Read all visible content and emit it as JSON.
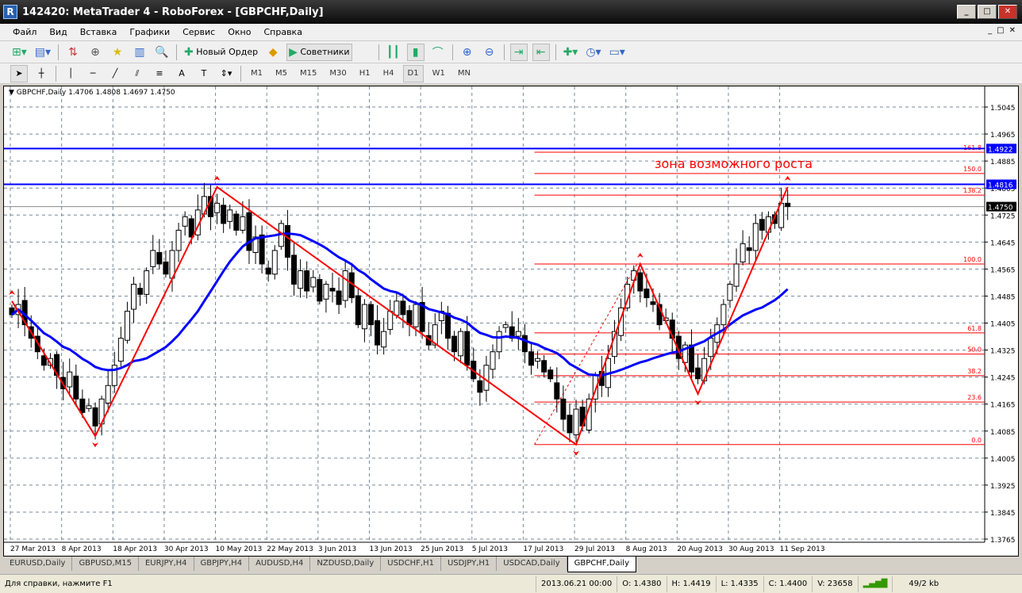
{
  "window": {
    "title": "142420: MetaTrader 4 - RoboForex - [GBPCHF,Daily]"
  },
  "menu": [
    "Файл",
    "Вид",
    "Вставка",
    "Графики",
    "Сервис",
    "Окно",
    "Справка"
  ],
  "toolbar": {
    "new_order": "Новый Ордер",
    "experts": "Советники"
  },
  "timeframes": [
    "M1",
    "M5",
    "M15",
    "M30",
    "H1",
    "H4",
    "D1",
    "W1",
    "MN"
  ],
  "active_timeframe": "D1",
  "chart_header": "GBPCHF,Daily  1.4706 1.4808 1.4697 1.4750",
  "annotation": "зона возможного роста",
  "colors": {
    "bull": "#ffffff",
    "bear": "#000000",
    "ma": "#0000ff",
    "zigzag": "#ff0000",
    "fib": "#ff0000",
    "hline": "#0000ff"
  },
  "chart_data": {
    "type": "candlestick",
    "symbol": "GBPCHF",
    "period": "Daily",
    "ylim": [
      1.3765,
      1.5045
    ],
    "price_ticks": [
      "1.5045",
      "1.4965",
      "1.4885",
      "1.4805",
      "1.4725",
      "1.4645",
      "1.4565",
      "1.4485",
      "1.4405",
      "1.4325",
      "1.4245",
      "1.4165",
      "1.4085",
      "1.4005",
      "1.3925",
      "1.3845",
      "1.3765"
    ],
    "date_ticks": [
      {
        "bar": 0,
        "label": "27 Mar 2013"
      },
      {
        "bar": 8,
        "label": "8 Apr 2013"
      },
      {
        "bar": 16,
        "label": "18 Apr 2013"
      },
      {
        "bar": 24,
        "label": "30 Apr 2013"
      },
      {
        "bar": 32,
        "label": "10 May 2013"
      },
      {
        "bar": 40,
        "label": "22 May 2013"
      },
      {
        "bar": 48,
        "label": "3 Jun 2013"
      },
      {
        "bar": 56,
        "label": "13 Jun 2013"
      },
      {
        "bar": 64,
        "label": "25 Jun 2013"
      },
      {
        "bar": 72,
        "label": "5 Jul 2013"
      },
      {
        "bar": 80,
        "label": "17 Jul 2013"
      },
      {
        "bar": 88,
        "label": "29 Jul 2013"
      },
      {
        "bar": 96,
        "label": "8 Aug 2013"
      },
      {
        "bar": 104,
        "label": "20 Aug 2013"
      },
      {
        "bar": 112,
        "label": "30 Aug 2013"
      },
      {
        "bar": 120,
        "label": "11 Sep 2013"
      }
    ],
    "closes": [
      1.443,
      1.446,
      1.44,
      1.436,
      1.432,
      1.428,
      1.43,
      1.425,
      1.421,
      1.426,
      1.418,
      1.414,
      1.416,
      1.41,
      1.418,
      1.422,
      1.428,
      1.436,
      1.444,
      1.452,
      1.449,
      1.456,
      1.462,
      1.458,
      1.455,
      1.462,
      1.468,
      1.472,
      1.466,
      1.474,
      1.478,
      1.472,
      1.476,
      1.47,
      1.474,
      1.468,
      1.472,
      1.462,
      1.466,
      1.458,
      1.455,
      1.462,
      1.47,
      1.46,
      1.452,
      1.456,
      1.45,
      1.454,
      1.447,
      1.452,
      1.45,
      1.446,
      1.456,
      1.448,
      1.44,
      1.446,
      1.44,
      1.434,
      1.438,
      1.444,
      1.447,
      1.443,
      1.44,
      1.446,
      1.438,
      1.434,
      1.44,
      1.444,
      1.436,
      1.432,
      1.438,
      1.428,
      1.424,
      1.42,
      1.428,
      1.432,
      1.438,
      1.44,
      1.436,
      1.438,
      1.432,
      1.428,
      1.43,
      1.426,
      1.424,
      1.418,
      1.412,
      1.408,
      1.415,
      1.41,
      1.418,
      1.425,
      1.422,
      1.43,
      1.438,
      1.445,
      1.452,
      1.456,
      1.45,
      1.448,
      1.446,
      1.44,
      1.442,
      1.436,
      1.43,
      1.434,
      1.426,
      1.424,
      1.43,
      1.436,
      1.44,
      1.446,
      1.452,
      1.458,
      1.464,
      1.462,
      1.47,
      1.468,
      1.472,
      1.47,
      1.476,
      1.475
    ],
    "ma_period": 20,
    "zigzag": [
      [
        0,
        1.447
      ],
      [
        13,
        1.407
      ],
      [
        32,
        1.4808
      ],
      [
        88,
        1.4045
      ],
      [
        98,
        1.458
      ],
      [
        107,
        1.4195
      ],
      [
        121,
        1.4808
      ]
    ],
    "fibo": {
      "start_bar": 82,
      "levels": [
        {
          "label": "0.0",
          "price": 1.4045
        },
        {
          "label": "23.6",
          "price": 1.4171
        },
        {
          "label": "38.2",
          "price": 1.4249
        },
        {
          "label": "50.0",
          "price": 1.4313
        },
        {
          "label": "61.8",
          "price": 1.4376
        },
        {
          "label": "100.0",
          "price": 1.458
        },
        {
          "label": "138.2",
          "price": 1.4784
        },
        {
          "label": "150.0",
          "price": 1.4848
        },
        {
          "label": "161.8",
          "price": 1.4911
        }
      ]
    },
    "hlines": [
      {
        "label": "1.4922",
        "price": 1.4922
      },
      {
        "label": "1.4816",
        "price": 1.4816
      }
    ],
    "last_price": {
      "label": "1.4750",
      "price": 1.475
    }
  },
  "tabs": [
    "EURUSD,Daily",
    "GBPUSD,M15",
    "EURJPY,H4",
    "GBPJPY,H4",
    "AUDUSD,H4",
    "NZDUSD,Daily",
    "USDCHF,H1",
    "USDJPY,H1",
    "USDCAD,Daily",
    "GBPCHF,Daily"
  ],
  "active_tab": "GBPCHF,Daily",
  "status": {
    "help": "Для справки, нажмите F1",
    "time": "2013.06.21 00:00",
    "open": "O: 1.4380",
    "high": "H: 1.4419",
    "low": "L: 1.4335",
    "close": "C: 1.4400",
    "volume": "V: 23658",
    "traffic": "49/2 kb"
  }
}
